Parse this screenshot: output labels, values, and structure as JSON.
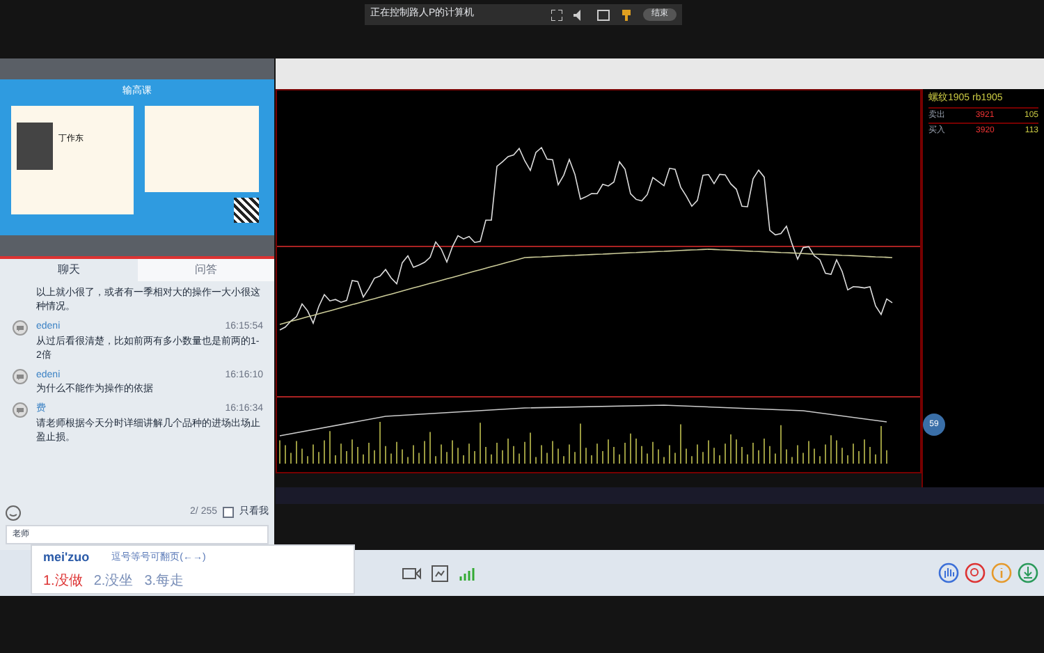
{
  "remote_bar": {
    "title": "正在控制路人P的计算机",
    "end_button": "结束"
  },
  "slide": {
    "brand": "输高课",
    "presenter": "丁作东"
  },
  "chat_tabs": [
    {
      "label": "聊天",
      "selected": true
    },
    {
      "label": "问答",
      "selected": false
    }
  ],
  "messages": [
    {
      "text": "以上就小很了，或者有一季相对大的操作一大小很这种情况。"
    },
    {
      "sender": "edeni",
      "time": "16:15:54",
      "text": "从过后看很清楚，比如前两有多小数量也是前两的1-2倍"
    },
    {
      "sender": "edeni",
      "time": "16:16:10",
      "text": "为什么不能作为操作的依据"
    },
    {
      "sender": "费",
      "time": "16:16:34",
      "text": "请老师根据今天分时详细讲解几个品种的进场出场止盈止损。"
    }
  ],
  "composer": {
    "count": "2/ 255",
    "only_me": {
      "label": "只看我",
      "checked": false
    },
    "recipient": "老师"
  },
  "ime": {
    "pinyin": "mei'zuo",
    "hint": "逗号等号可翻页(←→)",
    "candidates": [
      {
        "label": "1.没做",
        "selected": true
      },
      {
        "label": "2.没坐",
        "selected": false
      },
      {
        "label": "3.每走",
        "selected": false
      }
    ]
  },
  "quote": {
    "title": "螺纹1905 rb1905",
    "rows": [
      {
        "label": "卖出",
        "price": "3921",
        "volume": "105"
      },
      {
        "label": "买入",
        "price": "3920",
        "volume": "113"
      }
    ]
  },
  "badge": "59"
}
